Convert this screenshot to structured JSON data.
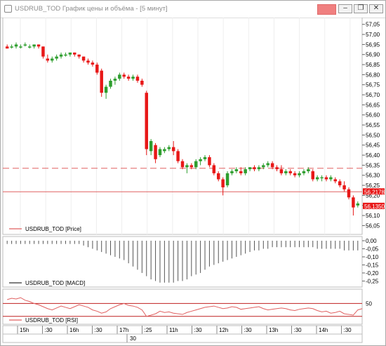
{
  "window": {
    "title": "USDRUB_TOD График цены и объёма - [5 минут]",
    "controls": [
      "minimize-icon",
      "restore-icon",
      "close-icon"
    ]
  },
  "colors": {
    "bull": "#2e9e2e",
    "bear": "#e81818",
    "price_line": "#e06060",
    "macd_bar": "#555555",
    "rsi_line": "#e06060",
    "rsi_level": "#c02020",
    "current_price_bg": "#e81818"
  },
  "price_panel": {
    "legend": "USDRUB_TOD [Price]",
    "price_ticks": [
      "57,05",
      "57,00",
      "56,95",
      "56,90",
      "56,85",
      "56,80",
      "56,75",
      "56,70",
      "56,65",
      "56,60",
      "56,55",
      "56,50",
      "56,45",
      "56,40",
      "56,35",
      "56,30",
      "56,25",
      "56,20",
      "56,15",
      "56,10",
      "56,05"
    ],
    "current_price_label": "56,2178",
    "last_price_label": "56,1350",
    "dashed_level": 56.335,
    "solid_level": 56.2178
  },
  "macd_panel": {
    "legend": "USDRUB_TOD [MACD]",
    "ticks": [
      "0,00",
      "-0,05",
      "-0,10",
      "-0,15",
      "-0,20",
      "-0,25"
    ]
  },
  "rsi_panel": {
    "legend": "USDRUB_TOD [RSI]",
    "ticks": [
      "50"
    ]
  },
  "time_axis": {
    "labels": [
      "15h",
      ":30",
      "16h",
      ":30",
      "17h",
      ":25",
      "11h",
      ":30",
      "12h",
      ":30",
      "13h",
      ":30",
      "14h",
      ":30"
    ],
    "date": "30"
  },
  "chart_data": {
    "type": "candlestick",
    "ylim": [
      56.02,
      57.07
    ],
    "candles": [
      [
        56.94,
        56.95,
        56.93,
        56.93
      ],
      [
        56.94,
        56.95,
        56.93,
        56.94
      ],
      [
        56.94,
        56.96,
        56.93,
        56.95
      ],
      [
        56.94,
        56.95,
        56.93,
        56.94
      ],
      [
        56.95,
        56.96,
        56.94,
        56.95
      ],
      [
        56.94,
        56.95,
        56.93,
        56.94
      ],
      [
        56.94,
        56.95,
        56.93,
        56.95
      ],
      [
        56.95,
        56.95,
        56.93,
        56.94
      ],
      [
        56.94,
        56.94,
        56.88,
        56.89
      ],
      [
        56.88,
        56.9,
        56.86,
        56.87
      ],
      [
        56.87,
        56.89,
        56.86,
        56.88
      ],
      [
        56.88,
        56.9,
        56.87,
        56.89
      ],
      [
        56.89,
        56.91,
        56.88,
        56.9
      ],
      [
        56.9,
        56.91,
        56.89,
        56.9
      ],
      [
        56.9,
        56.91,
        56.89,
        56.91
      ],
      [
        56.91,
        56.91,
        56.89,
        56.9
      ],
      [
        56.9,
        56.9,
        56.88,
        56.89
      ],
      [
        56.89,
        56.89,
        56.86,
        56.87
      ],
      [
        56.87,
        56.88,
        56.85,
        56.86
      ],
      [
        56.86,
        56.87,
        56.84,
        56.85
      ],
      [
        56.85,
        56.86,
        56.8,
        56.81
      ],
      [
        56.82,
        56.83,
        56.69,
        56.71
      ],
      [
        56.71,
        56.75,
        56.68,
        56.74
      ],
      [
        56.74,
        56.78,
        56.73,
        56.77
      ],
      [
        56.77,
        56.79,
        56.75,
        56.78
      ],
      [
        56.78,
        56.81,
        56.77,
        56.8
      ],
      [
        56.8,
        56.81,
        56.78,
        56.79
      ],
      [
        56.79,
        56.8,
        56.77,
        56.78
      ],
      [
        56.78,
        56.8,
        56.77,
        56.79
      ],
      [
        56.79,
        56.8,
        56.76,
        56.77
      ],
      [
        56.77,
        56.78,
        56.74,
        56.75
      ],
      [
        56.71,
        56.72,
        56.4,
        56.43
      ],
      [
        56.42,
        56.48,
        56.4,
        56.47
      ],
      [
        56.45,
        56.46,
        56.36,
        56.38
      ],
      [
        56.4,
        56.44,
        56.39,
        56.43
      ],
      [
        56.42,
        56.44,
        56.41,
        56.43
      ],
      [
        56.43,
        56.45,
        56.42,
        56.44
      ],
      [
        56.44,
        56.47,
        56.4,
        56.42
      ],
      [
        56.42,
        56.43,
        56.36,
        56.37
      ],
      [
        56.37,
        56.38,
        56.33,
        56.34
      ],
      [
        56.34,
        56.36,
        56.31,
        56.35
      ],
      [
        56.35,
        56.36,
        56.33,
        56.34
      ],
      [
        56.34,
        56.38,
        56.33,
        56.37
      ],
      [
        56.37,
        56.39,
        56.35,
        56.38
      ],
      [
        56.38,
        56.4,
        56.37,
        56.39
      ],
      [
        56.39,
        56.4,
        56.34,
        56.35
      ],
      [
        56.35,
        56.36,
        56.3,
        56.31
      ],
      [
        56.31,
        56.32,
        56.27,
        56.28
      ],
      [
        56.28,
        56.29,
        56.2,
        56.24
      ],
      [
        56.25,
        56.32,
        56.24,
        56.31
      ],
      [
        56.31,
        56.33,
        56.3,
        56.32
      ],
      [
        56.32,
        56.34,
        56.31,
        56.33
      ],
      [
        56.32,
        56.34,
        56.3,
        56.31
      ],
      [
        56.31,
        56.34,
        56.3,
        56.33
      ],
      [
        56.33,
        56.34,
        56.32,
        56.34
      ],
      [
        56.34,
        56.35,
        56.32,
        56.33
      ],
      [
        56.33,
        56.35,
        56.32,
        56.34
      ],
      [
        56.34,
        56.36,
        56.33,
        56.35
      ],
      [
        56.35,
        56.37,
        56.34,
        56.36
      ],
      [
        56.36,
        56.37,
        56.33,
        56.34
      ],
      [
        56.34,
        56.35,
        56.32,
        56.33
      ],
      [
        56.33,
        56.35,
        56.3,
        56.31
      ],
      [
        56.31,
        56.33,
        56.3,
        56.32
      ],
      [
        56.32,
        56.33,
        56.3,
        56.31
      ],
      [
        56.31,
        56.32,
        56.29,
        56.3
      ],
      [
        56.3,
        56.32,
        56.29,
        56.31
      ],
      [
        56.31,
        56.33,
        56.3,
        56.32
      ],
      [
        56.32,
        56.34,
        56.31,
        56.33
      ],
      [
        56.32,
        56.33,
        56.27,
        56.28
      ],
      [
        56.28,
        56.3,
        56.27,
        56.29
      ],
      [
        56.29,
        56.3,
        56.27,
        56.29
      ],
      [
        56.29,
        56.3,
        56.27,
        56.28
      ],
      [
        56.28,
        56.3,
        56.27,
        56.29
      ],
      [
        56.28,
        56.29,
        56.26,
        56.27
      ],
      [
        56.27,
        56.28,
        56.24,
        56.25
      ],
      [
        56.25,
        56.27,
        56.22,
        56.23
      ],
      [
        56.23,
        56.24,
        56.18,
        56.19
      ],
      [
        56.19,
        56.2,
        56.1,
        56.14
      ],
      [
        56.15,
        56.17,
        56.14,
        56.16
      ]
    ],
    "macd": [
      -0.02,
      -0.02,
      -0.02,
      -0.02,
      -0.02,
      -0.02,
      -0.02,
      -0.02,
      -0.02,
      -0.02,
      -0.02,
      -0.02,
      -0.02,
      -0.02,
      -0.02,
      -0.02,
      -0.02,
      -0.03,
      -0.04,
      -0.05,
      -0.06,
      -0.07,
      -0.08,
      -0.09,
      -0.1,
      -0.11,
      -0.12,
      -0.14,
      -0.16,
      -0.18,
      -0.2,
      -0.22,
      -0.24,
      -0.25,
      -0.26,
      -0.26,
      -0.26,
      -0.26,
      -0.25,
      -0.25,
      -0.24,
      -0.22,
      -0.21,
      -0.2,
      -0.18,
      -0.16,
      -0.15,
      -0.14,
      -0.13,
      -0.12,
      -0.11,
      -0.1,
      -0.09,
      -0.08,
      -0.07,
      -0.06,
      -0.06,
      -0.05,
      -0.05,
      -0.04,
      -0.04,
      -0.04,
      -0.04,
      -0.04,
      -0.04,
      -0.04,
      -0.04,
      -0.04,
      -0.04,
      -0.05,
      -0.05,
      -0.05,
      -0.05,
      -0.05,
      -0.05,
      -0.06,
      -0.06,
      -0.06,
      -0.06
    ],
    "rsi": [
      56,
      58,
      57,
      59,
      55,
      53,
      50,
      48,
      45,
      42,
      40,
      43,
      46,
      44,
      42,
      45,
      48,
      46,
      44,
      40,
      38,
      35,
      37,
      42,
      45,
      48,
      50,
      47,
      46,
      44,
      40,
      30,
      32,
      34,
      38,
      36,
      37,
      35,
      34,
      33,
      36,
      38,
      40,
      42,
      44,
      45,
      46,
      44,
      42,
      43,
      45,
      44,
      41,
      42,
      43,
      44,
      45,
      42,
      40,
      41,
      42,
      43,
      42,
      40,
      39,
      41,
      42,
      43,
      42,
      39,
      37,
      38,
      35,
      36,
      38,
      34,
      33,
      32,
      40,
      42
    ],
    "rsi_levels": [
      50,
      30
    ]
  }
}
